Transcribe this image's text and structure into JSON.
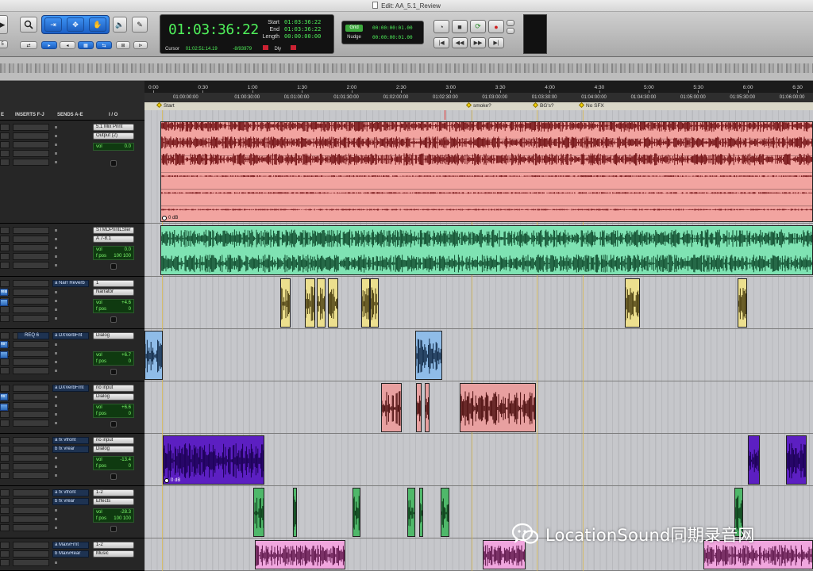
{
  "window": {
    "title": "Edit: AA_5.1_Review"
  },
  "counter": {
    "main_time": "01:03:36:22",
    "start_label": "Start",
    "end_label": "End",
    "length_label": "Length",
    "start_value": "01:03:36:22",
    "end_value": "01:03:36:22",
    "length_value": "00:00:00:00",
    "cursor_label": "Cursor",
    "cursor_value": "01:02:51:14.19",
    "sample_value": "-8/93979",
    "dly_label": "Dly"
  },
  "grid_nudge": {
    "grid_label": "Grid",
    "grid_value": "00:00:00:01.00",
    "nudge_label": "Nudge",
    "nudge_value": "00:00:00:01.00"
  },
  "ruler": {
    "minsecs": [
      "0:00",
      "0:30",
      "1:00",
      "1:30",
      "2:00",
      "2:30",
      "3:00",
      "3:30",
      "4:00",
      "4:30",
      "5:00",
      "5:30",
      "6:00",
      "6:30"
    ],
    "timecodes": [
      "01:00:00:00",
      "01:00:30:00",
      "01:01:00:00",
      "01:01:30:00",
      "01:02:00:00",
      "01:02:30:00",
      "01:03:00:00",
      "01:03:30:00",
      "01:04:00:00",
      "01:04:30:00",
      "01:05:00:00",
      "01:05:30:00",
      "01:06:00:00"
    ],
    "markers": [
      {
        "label": "Start"
      },
      {
        "label": "smoke?"
      },
      {
        "label": "BG's?"
      },
      {
        "label": "No SFX"
      }
    ]
  },
  "column_headers": {
    "inserts_ae": "E",
    "inserts_fj": "INSERTS F-J",
    "sends": "SENDS A-E",
    "io": "I / O"
  },
  "tracks": [
    {
      "send": "",
      "insert": "",
      "left": "",
      "io_out": "5.1 Mix Print",
      "io_in": "Output (2)",
      "vol": "0.0",
      "pan": "",
      "color": "#f2a4a0",
      "wave": "#6e0d10",
      "clip_label": "0 dB"
    },
    {
      "send": "",
      "insert": "",
      "left": "",
      "io_out": "STMDPrintLSter",
      "io_in": "A 7-8.1",
      "vol": "0.0",
      "pan": "100    100",
      "color": "#7fe3b3",
      "wave": "#0f4a2c",
      "clip_label": ""
    },
    {
      "send": "a  Narr Reverb",
      "insert": "",
      "left": "rear",
      "io_out": "1",
      "io_in": "Narrator",
      "vol": "+4.6",
      "pan": "0",
      "color": "#ecdf8e",
      "wave": "#4a3d10",
      "clip_label": ""
    },
    {
      "send": "a  DXVerbFnt",
      "insert": "REQ 6",
      "left": "ns",
      "io_out": "Dialog",
      "io_in": "",
      "vol": "+6.7",
      "pan": "0",
      "color": "#8fbce8",
      "wave": "#102845",
      "clip_label": ""
    },
    {
      "send": "a  DXVerbFrnt",
      "insert": "",
      "left": "ns",
      "io_out": "no input",
      "io_in": "Dialog",
      "vol": "+6.6",
      "pan": "0",
      "color": "#e8a0a0",
      "wave": "#4a0c0c",
      "clip_label": ""
    },
    {
      "send": "a  fx vfront",
      "insert": "",
      "left": "",
      "io_out": "no input",
      "io_in": "Dialog",
      "vol": "-13.4",
      "pan": "0",
      "color": "#5c1fc2",
      "wave": "#1a0052",
      "clip_label": "0 dB",
      "send2": "b  fx vrear"
    },
    {
      "send": "a  fx vfront",
      "insert": "",
      "left": "",
      "io_out": "1-2",
      "io_in": "Effects",
      "vol": "-28.3",
      "pan": "100    100",
      "color": "#4fb86a",
      "wave": "#0b3b18",
      "clip_label": "",
      "send2": "b  fx vrear"
    },
    {
      "send": "a  MaxvFrnt",
      "insert": "",
      "left": "",
      "io_out": "1-2",
      "io_in": "Music",
      "vol": "",
      "pan": "",
      "color": "#f0a6de",
      "wave": "#5c1448",
      "clip_label": "",
      "send2": "b  MaxvRear"
    }
  ],
  "vol_label": "vol",
  "pan_label": "f pos",
  "watermark": {
    "text": "LocationSound同期录音网"
  },
  "colors": {
    "accent_blue": "#2a6fd6",
    "counter_green": "#4ff05a",
    "marker_yellow": "#f3d000"
  }
}
